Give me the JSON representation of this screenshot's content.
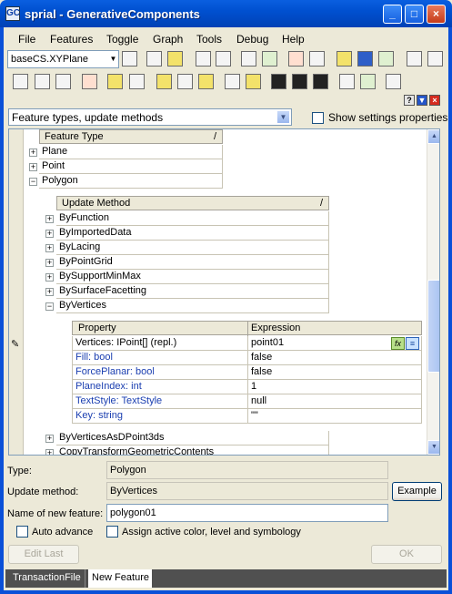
{
  "window": {
    "title": "sprial - GenerativeComponents",
    "icon": "gc-app-icon"
  },
  "menu": [
    "File",
    "Features",
    "Toggle",
    "Graph",
    "Tools",
    "Debug",
    "Help"
  ],
  "toolbar": {
    "coordinate_system": "baseCS.XYPlane"
  },
  "panel": {
    "filter_combo": "Feature types, update methods",
    "show_settings_label": "Show settings properties"
  },
  "tree": {
    "feature_type_header": "Feature Type",
    "feature_types": [
      "Plane",
      "Point",
      "Polygon"
    ],
    "update_method_header": "Update Method",
    "update_methods": [
      "ByFunction",
      "ByImportedData",
      "ByLacing",
      "ByPointGrid",
      "BySupportMinMax",
      "BySurfaceFacetting",
      "ByVertices"
    ],
    "after_methods": [
      "ByVerticesAsDPoint3ds",
      "CopyTransformGeometricContents"
    ],
    "slash": "/",
    "property_header": "Property",
    "expression_header": "Expression",
    "properties": [
      {
        "name": "Vertices: IPoint[] (repl.)",
        "expression": "point01"
      },
      {
        "name": "Fill: bool",
        "expression": "false"
      },
      {
        "name": "ForcePlanar: bool",
        "expression": "false"
      },
      {
        "name": "PlaneIndex: int",
        "expression": "1"
      },
      {
        "name": "TextStyle: TextStyle",
        "expression": "null"
      },
      {
        "name": "Key: string",
        "expression": "\"\""
      }
    ],
    "fx_label": "fx"
  },
  "form": {
    "type_label": "Type:",
    "type_value": "Polygon",
    "method_label": "Update method:",
    "method_value": "ByVertices",
    "example_button": "Example",
    "name_label": "Name of new feature:",
    "name_value": "polygon01",
    "auto_advance_label": "Auto advance",
    "assign_label": "Assign active color, level and symbology",
    "edit_last_button": "Edit Last",
    "ok_button": "OK"
  },
  "tabs": [
    "TransactionFile",
    "New Feature"
  ]
}
